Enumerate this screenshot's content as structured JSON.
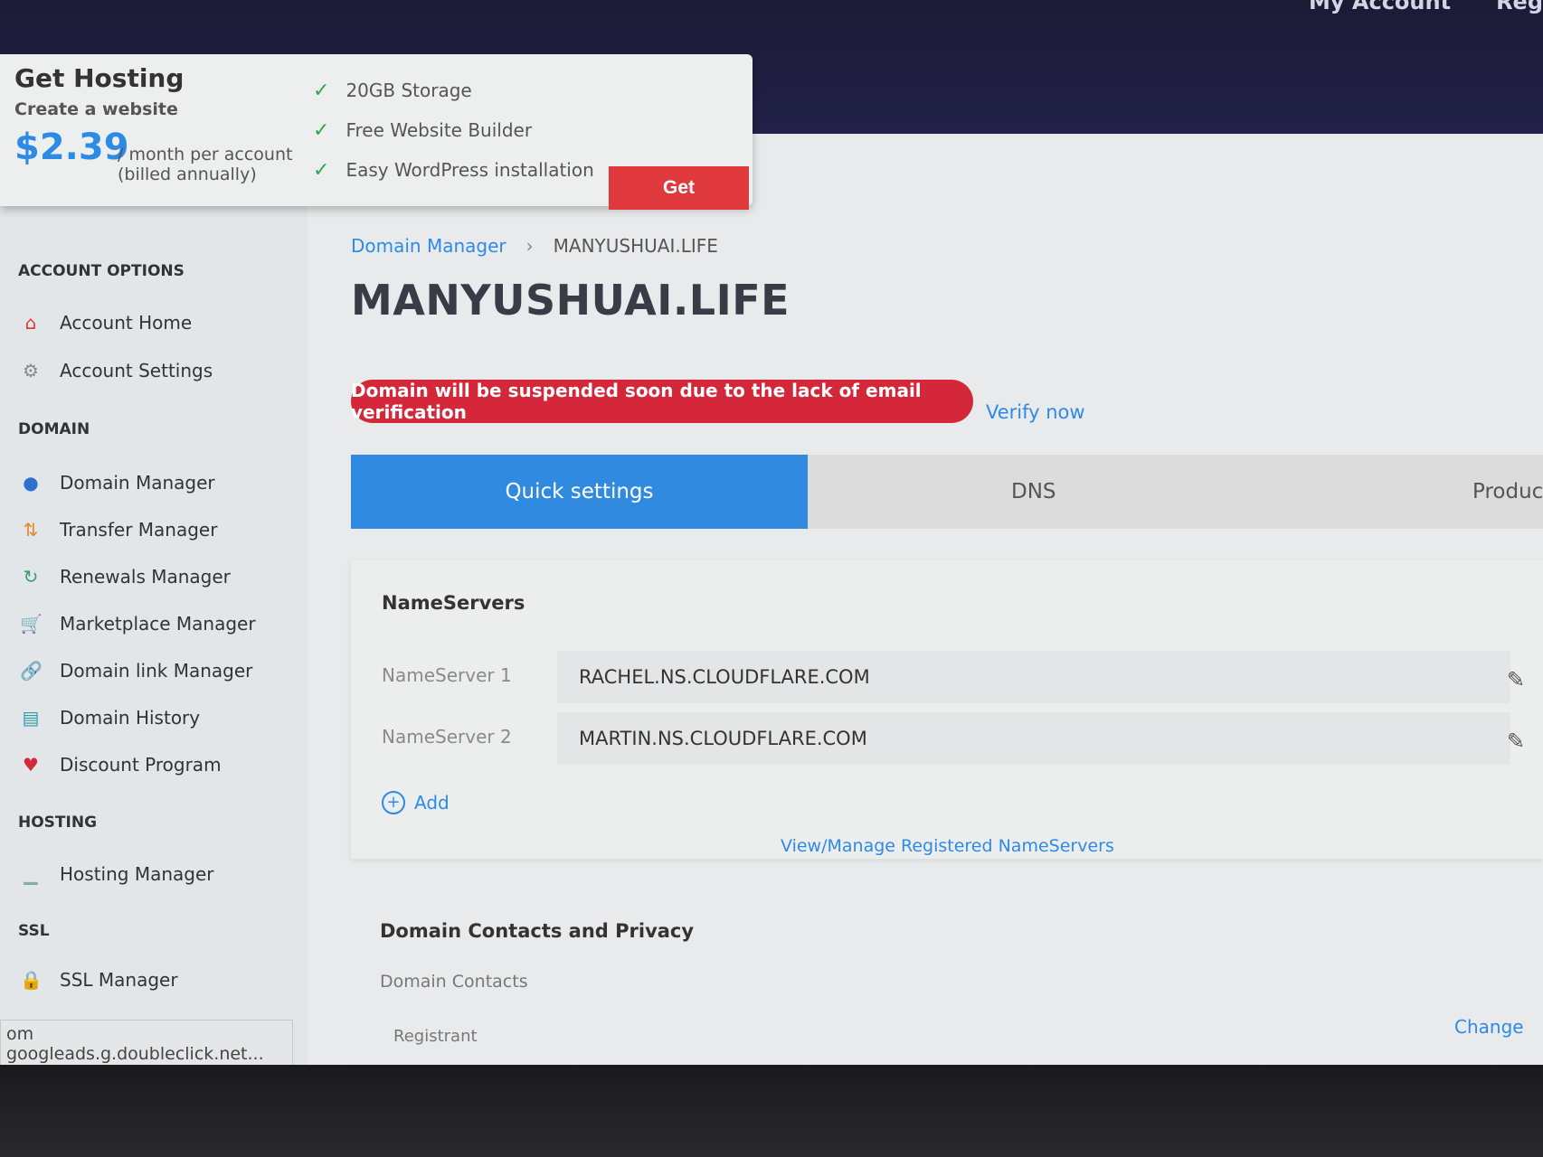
{
  "top_nav": [
    "My Account",
    "Reg"
  ],
  "promo": {
    "title": "Get Hosting",
    "subtitle": "Create a website",
    "price": "$2.39",
    "price_note_line1": "/ month per account",
    "price_note_line2": "(billed annually)",
    "features": [
      "20GB Storage",
      "Free Website Builder",
      "Easy WordPress installation"
    ],
    "get_label": "Get"
  },
  "sidebar": {
    "account_title": "ACCOUNT OPTIONS",
    "account_items": [
      "Account Home",
      "Account Settings"
    ],
    "domain_title": "DOMAIN",
    "domain_items": [
      "Domain Manager",
      "Transfer Manager",
      "Renewals Manager",
      "Marketplace Manager",
      "Domain link Manager",
      "Domain History",
      "Discount Program"
    ],
    "hosting_title": "HOSTING",
    "hosting_items": [
      "Hosting Manager"
    ],
    "ssl_title": "SSL",
    "ssl_items": [
      "SSL Manager"
    ]
  },
  "status_url": "om googleads.g.doubleclick.net...",
  "breadcrumb": {
    "link": "Domain Manager",
    "separator": "›",
    "current": "MANYUSHUAI.LIFE"
  },
  "page_title": "MANYUSHUAI.LIFE",
  "alert": {
    "text": "Domain will be suspended soon due to the lack of email verification",
    "verify_label": "Verify now"
  },
  "tabs": [
    "Quick settings",
    "DNS",
    "Produc"
  ],
  "nameservers": {
    "title": "NameServers",
    "rows": [
      {
        "label": "NameServer 1",
        "value": "RACHEL.NS.CLOUDFLARE.COM"
      },
      {
        "label": "NameServer 2",
        "value": "MARTIN.NS.CLOUDFLARE.COM"
      }
    ],
    "add_label": "Add",
    "view_link": "View/Manage Registered NameServers"
  },
  "contacts": {
    "title": "Domain Contacts and Privacy",
    "subtitle": "Domain Contacts",
    "registrant": "Registrant",
    "change_label": "Change"
  },
  "colors": {
    "accent_blue": "#2f8ae0",
    "alert_red": "#d4283a",
    "get_red": "#e03a3e",
    "check_green": "#2fa84f"
  }
}
